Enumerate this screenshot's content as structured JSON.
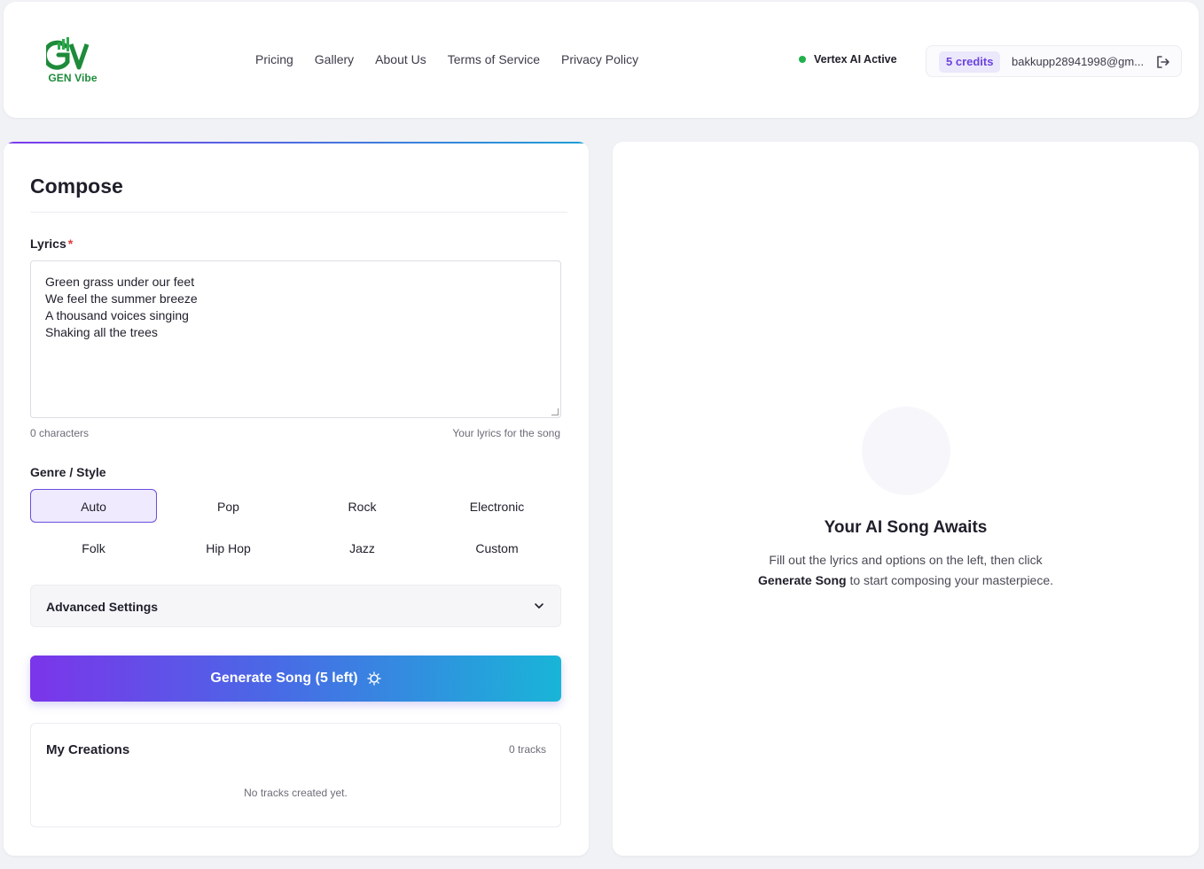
{
  "header": {
    "logo_text": "GEN Vibe",
    "nav": [
      "Pricing",
      "Gallery",
      "About Us",
      "Terms of Service",
      "Privacy Policy"
    ],
    "status": "Vertex AI Active",
    "credits": "5 credits",
    "email": "bakkupp28941998@gm...",
    "icons": {
      "logo": "gv-logo-icon",
      "logout": "logout-icon"
    }
  },
  "compose": {
    "title": "Compose",
    "lyrics_label": "Lyrics",
    "required_marker": "*",
    "lyrics_value": "Green grass under our feet\nWe feel the summer breeze\nA thousand voices singing\nShaking all the trees",
    "char_count": "0 characters",
    "lyrics_hint": "Your lyrics for the song",
    "genre_label": "Genre / Style",
    "genres": [
      "Auto",
      "Pop",
      "Rock",
      "Electronic",
      "Folk",
      "Hip Hop",
      "Jazz",
      "Custom"
    ],
    "selected_genre": "Auto",
    "advanced_label": "Advanced Settings",
    "generate_label": "Generate Song (5 left)"
  },
  "creations": {
    "title": "My Creations",
    "count": "0 tracks",
    "empty": "No tracks created yet."
  },
  "preview": {
    "title": "Your AI Song Awaits",
    "text_line1": "Fill out the lyrics and options on the left, then click",
    "text_bold": "Generate Song",
    "text_line2_rest": " to start composing your masterpiece.",
    "icon": "soundwave-icon"
  },
  "colors": {
    "accent": "#6c4ee0",
    "gradient_start": "#7b35ea",
    "gradient_end": "#19b5d8",
    "status_green": "#22b04b",
    "logo_green": "#1e8b3a"
  }
}
